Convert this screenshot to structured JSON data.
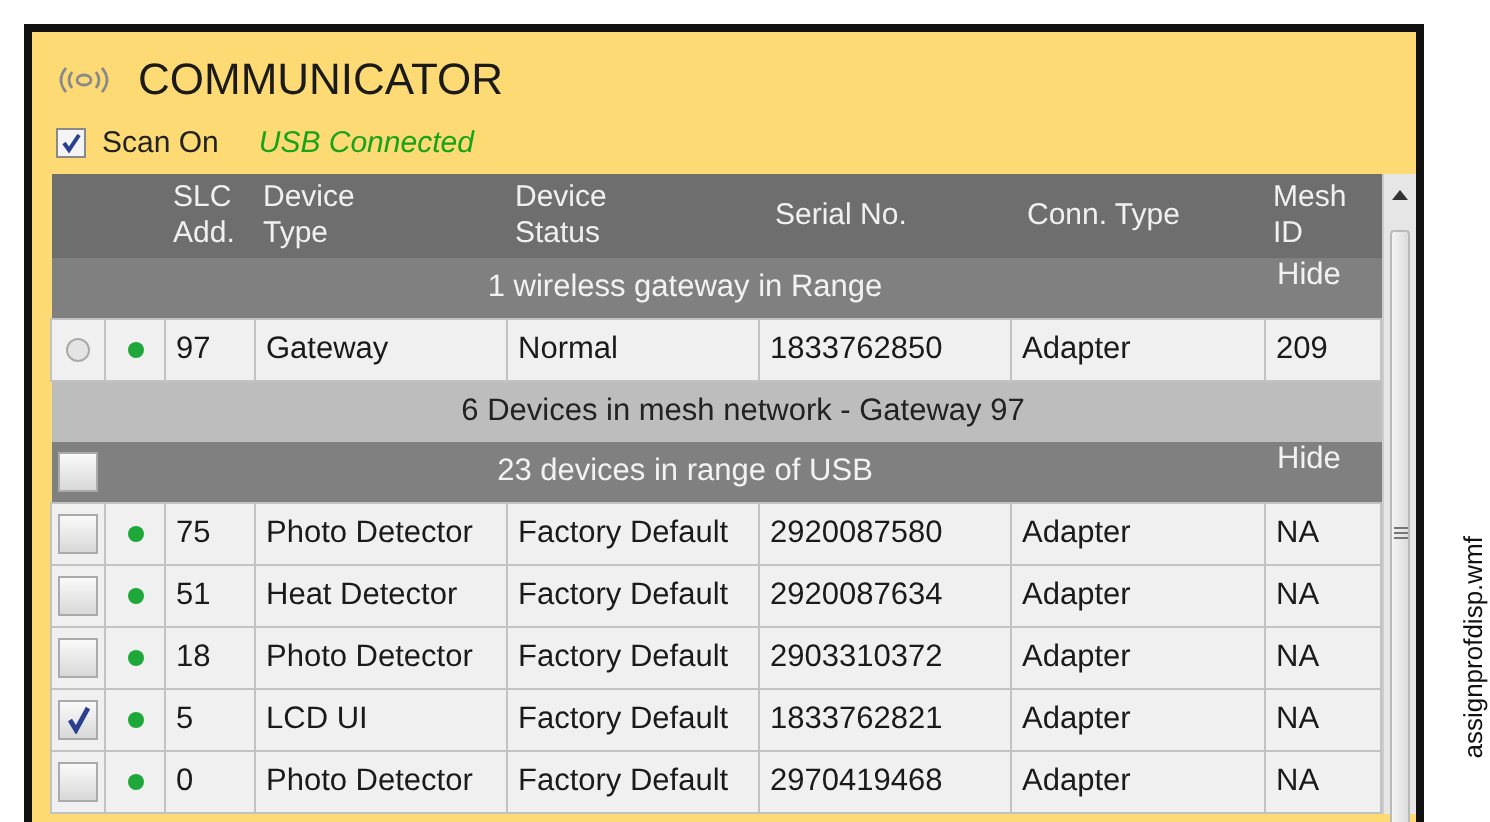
{
  "panel": {
    "title": "COMMUNICATOR",
    "scan": {
      "label": "Scan On",
      "checked": true
    },
    "connection": "USB Connected"
  },
  "table": {
    "columns": [
      {
        "lines": [
          "SLC",
          "Add."
        ]
      },
      {
        "lines": [
          "Device",
          "Type"
        ]
      },
      {
        "lines": [
          "Device",
          "Status"
        ]
      },
      {
        "lines": [
          "Serial No."
        ]
      },
      {
        "lines": [
          "Conn. Type"
        ]
      },
      {
        "lines": [
          "Mesh",
          "ID"
        ]
      }
    ],
    "rows": [
      {
        "kind": "header",
        "label": "1 wireless gateway in Range",
        "action": "Hide"
      },
      {
        "kind": "gateway",
        "selected": false,
        "online": true,
        "cells": [
          "97",
          "Gateway",
          "Normal",
          "1833762850",
          "Adapter",
          "209"
        ]
      },
      {
        "kind": "subheader",
        "label": "6 Devices in mesh network - Gateway 97"
      },
      {
        "kind": "header",
        "label": "23 devices in range of USB",
        "action": "Hide",
        "checked": false
      },
      {
        "kind": "device",
        "checked": false,
        "online": true,
        "cells": [
          "75",
          "Photo Detector",
          "Factory Default",
          "2920087580",
          "Adapter",
          "NA"
        ]
      },
      {
        "kind": "device",
        "checked": false,
        "online": true,
        "cells": [
          "51",
          "Heat Detector",
          "Factory Default",
          "2920087634",
          "Adapter",
          "NA"
        ]
      },
      {
        "kind": "device",
        "checked": false,
        "online": true,
        "cells": [
          "18",
          "Photo Detector",
          "Factory Default",
          "2903310372",
          "Adapter",
          "NA"
        ]
      },
      {
        "kind": "device",
        "checked": true,
        "online": true,
        "cells": [
          "5",
          "LCD UI",
          "Factory Default",
          "1833762821",
          "Adapter",
          "NA"
        ]
      },
      {
        "kind": "device",
        "checked": false,
        "online": true,
        "cells": [
          "0",
          "Photo Detector",
          "Factory Default",
          "2970419468",
          "Adapter",
          "NA"
        ]
      }
    ]
  },
  "caption": "assignprofdisp.wmf"
}
